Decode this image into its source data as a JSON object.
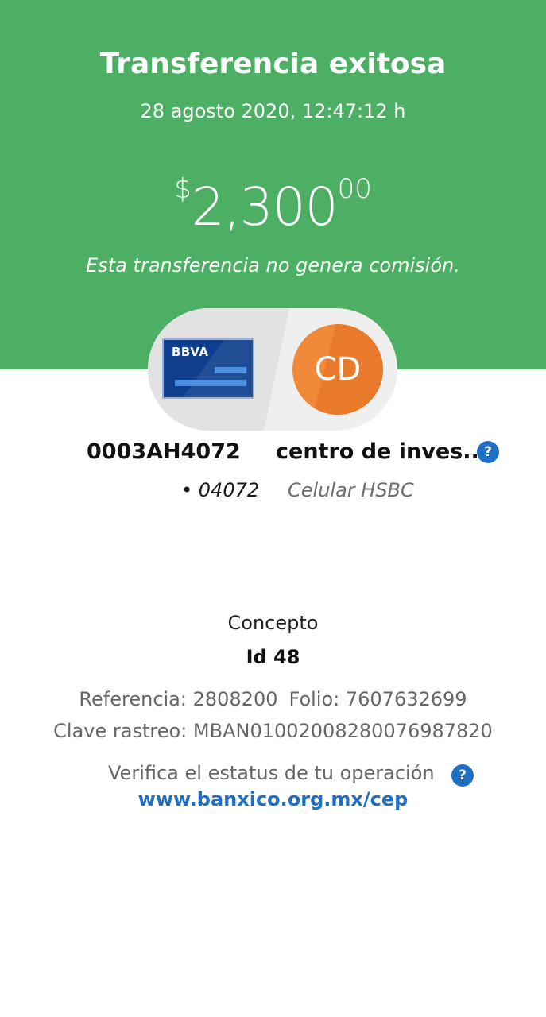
{
  "header": {
    "title": "Transferencia exitosa",
    "datetime": "28 agosto 2020, 12:47:12 h",
    "amount": {
      "currency": "$",
      "integer": "2,300",
      "decimals": "00"
    },
    "commission_note": "Esta transferencia no genera comisión.",
    "background_color": "#4caf64"
  },
  "origin": {
    "bank_name": "BBVA",
    "account": "0003AH4072",
    "detail": "• 04072"
  },
  "destination": {
    "avatar_initials": "CD",
    "avatar_color": "#f08a3a",
    "name": "centro de inves...",
    "detail": "Celular HSBC",
    "help_icon": "question-mark-icon"
  },
  "concept": {
    "label": "Concepto",
    "value": "Id 48"
  },
  "reference": {
    "reference_text": "Referencia: 2808200",
    "folio_text": "Folio: 7607632699",
    "tracking_text": "Clave rastreo: MBAN01002008280076987820"
  },
  "verify": {
    "text": "Verifica el estatus de tu operación",
    "help_icon": "question-mark-icon",
    "link": "www.banxico.org.mx/cep",
    "link_color": "#1f6fc5"
  }
}
